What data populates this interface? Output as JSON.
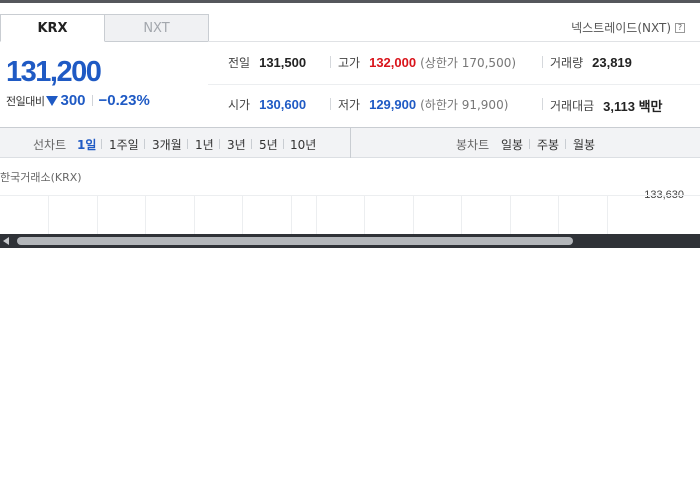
{
  "tabs": [
    {
      "label": "KRX",
      "active": true
    },
    {
      "label": "NXT",
      "active": false
    }
  ],
  "nxt_link": {
    "label": "넥스트레이드(NXT)",
    "icon": "?"
  },
  "quote": {
    "price": "131,200",
    "change_label": "전일대비",
    "change_direction": "down",
    "change_value": "300",
    "change_pct": "−0.23%"
  },
  "stats": {
    "prev_close": {
      "label": "전일",
      "value": "131,500"
    },
    "high": {
      "label": "고가",
      "value": "132,000",
      "sub": "(상한가 170,500)"
    },
    "volume": {
      "label": "거래량",
      "value": "23,819"
    },
    "open": {
      "label": "시가",
      "value": "130,600"
    },
    "low": {
      "label": "저가",
      "value": "129,900",
      "sub": "(하한가 91,900)"
    },
    "amount": {
      "label": "거래대금",
      "value": "3,113 백만"
    }
  },
  "chart_toolbar": {
    "line_label": "선차트",
    "line_items": [
      "1일",
      "1주일",
      "3개월",
      "1년",
      "3년",
      "5년",
      "10년"
    ],
    "active_index": 0,
    "candle_label": "봉차트",
    "candle_items": [
      "일봉",
      "주봉",
      "월봉"
    ]
  },
  "chart": {
    "source": "한국거래소(KRX)",
    "top_value": "133,630"
  },
  "colors": {
    "up": "#d9141b",
    "down": "#1f5ac4"
  }
}
